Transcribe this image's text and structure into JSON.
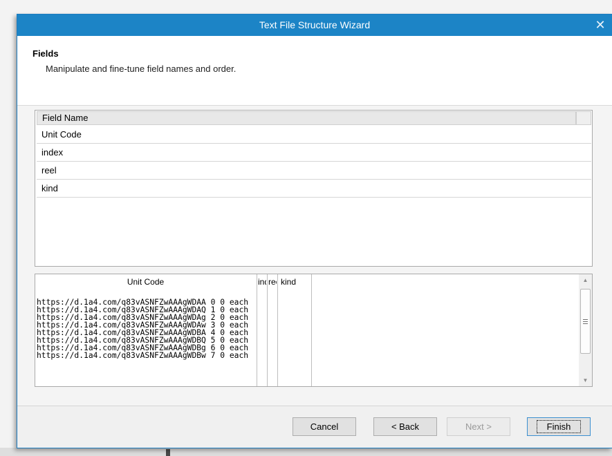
{
  "window": {
    "title": "Text File Structure Wizard",
    "close_glyph": "✕"
  },
  "header": {
    "title": "Fields",
    "subtitle": "Manipulate and fine-tune field names and order."
  },
  "fields": {
    "column_header": "Field Name",
    "rows": [
      "Unit Code",
      "index",
      "reel",
      "kind"
    ]
  },
  "preview": {
    "columns": [
      "Unit Code",
      "index",
      "reel",
      "kind"
    ],
    "rows": [
      "https://d.1a4.com/q83vASNFZwAAAgWDAA 0 0 each",
      "https://d.1a4.com/q83vASNFZwAAAgWDAQ 1 0 each",
      "https://d.1a4.com/q83vASNFZwAAAgWDAg 2 0 each",
      "https://d.1a4.com/q83vASNFZwAAAgWDAw 3 0 each",
      "https://d.1a4.com/q83vASNFZwAAAgWDBA 4 0 each",
      "https://d.1a4.com/q83vASNFZwAAAgWDBQ 5 0 each",
      "https://d.1a4.com/q83vASNFZwAAAgWDBg 6 0 each",
      "https://d.1a4.com/q83vASNFZwAAAgWDBw 7 0 each"
    ],
    "scroll_up_glyph": "▲",
    "scroll_down_glyph": "▼"
  },
  "buttons": {
    "cancel": "Cancel",
    "back": "< Back",
    "next": "Next >",
    "finish": "Finish"
  },
  "colors": {
    "titlebar": "#1c84c6",
    "window_border": "#1a7bbf",
    "default_button_border": "#3a8fd0"
  }
}
